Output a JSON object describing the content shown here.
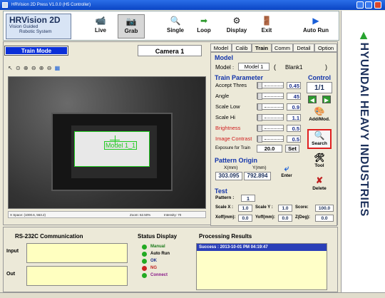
{
  "window": {
    "title": "HRVision 2D Press V1.0.0 (H5 Controller)"
  },
  "logo": {
    "line1": "HRVision 2D",
    "line2": "Vision Guided",
    "line3": "Robotic System"
  },
  "toolbar": {
    "live": "Live",
    "grab": "Grab",
    "single": "Single",
    "loop": "Loop",
    "display": "Display",
    "exit": "Exit",
    "auto_run": "Auto Run"
  },
  "left": {
    "mode": "Train Mode",
    "camera": "Camera 1",
    "status": {
      "pos": "X Space: (1000.6, 563.2)",
      "zoom": "Zoom: 62.50%",
      "intensity": "Intensity: 70"
    },
    "roi_label": "Model 1_1"
  },
  "tabs": [
    "Model",
    "Calib",
    "Train",
    "Comm",
    "Detail",
    "Option"
  ],
  "active_tab": "Train",
  "model": {
    "section": "Model",
    "label": "Model",
    "name": "Model 1",
    "paren_open": "(",
    "blank": "Blank1",
    "paren_close": ")"
  },
  "train": {
    "section": "Train Parameter",
    "params": [
      {
        "label": "Accept Thres",
        "value": "0.45"
      },
      {
        "label": "Angle",
        "value": "45"
      },
      {
        "label": "Scale Low",
        "value": "0.9"
      },
      {
        "label": "Scale Hi",
        "value": "1.1"
      },
      {
        "label": "Brightness",
        "value": "0.5"
      },
      {
        "label": "Image Contrast",
        "value": "0.5"
      }
    ],
    "exposure_label": "Exposure for Train",
    "exposure_value": "20.0",
    "set": "Set"
  },
  "control": {
    "section": "Control",
    "count": "1/1",
    "add": "Add/Mod.",
    "search": "Search",
    "tool": "Tool",
    "delete": "Delete"
  },
  "origin": {
    "section": "Pattern Origin",
    "xlabel": "X(mm)",
    "ylabel": "Y(mm)",
    "x": "303.095",
    "y": "792.894",
    "enter": "Enter"
  },
  "test": {
    "section": "Test",
    "pattern_label": "Pattern :",
    "pattern": "1",
    "scalex_label": "Scale X :",
    "scalex": "1.0",
    "scaley_label": "Scale Y :",
    "scaley": "1.0",
    "score_label": "Score:",
    "score": "100.0",
    "xoff_label": "Xoff(mm):",
    "xoff": "0.0",
    "yoff_label": "Yoff(mm):",
    "yoff": "0.0",
    "zdeg_label": "Z(Deg):",
    "zdeg": "0.0"
  },
  "rs232": {
    "title": "RS-232C Communication",
    "input": "Input",
    "output": "Out"
  },
  "status_display": {
    "title": "Status Display",
    "items": [
      {
        "label": "Manual",
        "color": "#22aa22"
      },
      {
        "label": "Auto Run",
        "color": "#22aa22"
      },
      {
        "label": "OK",
        "color": "#22aa22"
      },
      {
        "label": "NG",
        "color": "#cc2222"
      },
      {
        "label": "Connect",
        "color": "#22aa22"
      }
    ]
  },
  "processing": {
    "title": "Processing Results",
    "line": "Success : 2013-10-01 PM 04:19:47"
  },
  "brand": "HYUNDAI HEAVY INDUSTRIES",
  "colors": {
    "accent": "#0a2fd8",
    "highlight": "#e02020",
    "brand": "#1b2f5a",
    "panel": "#ffffc0"
  }
}
